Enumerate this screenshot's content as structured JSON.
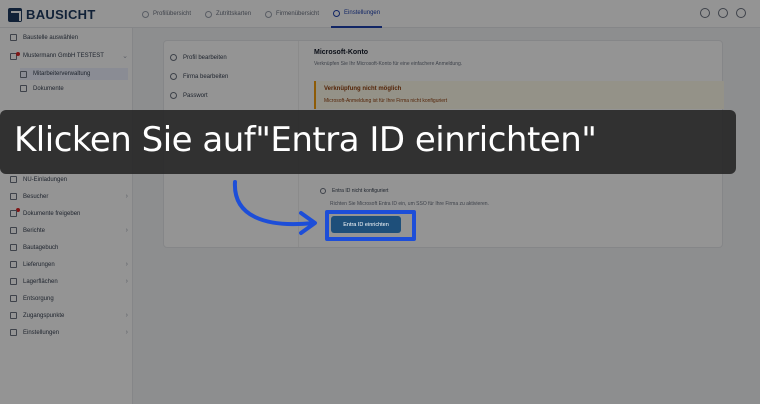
{
  "brand": {
    "name": "BAUSICHT"
  },
  "nav": {
    "tabs": [
      {
        "label": "Profilübersicht",
        "icon": "user-icon"
      },
      {
        "label": "Zutrittskarten",
        "icon": "card-icon"
      },
      {
        "label": "Firmenübersicht",
        "icon": "building-icon"
      },
      {
        "label": "Einstellungen",
        "icon": "gear-icon",
        "active": true
      }
    ]
  },
  "sidebar": {
    "select_site": "Baustelle auswählen",
    "company": "Mustermann GmbH TESTEST",
    "items": [
      {
        "label": "Mitarbeiterverwaltung"
      },
      {
        "label": "Dokumente"
      },
      {
        "label": "NU-Einladungen"
      },
      {
        "label": "Besucher"
      },
      {
        "label": "Dokumente freigeben"
      },
      {
        "label": "Berichte"
      },
      {
        "label": "Bautagebuch"
      },
      {
        "label": "Lieferungen"
      },
      {
        "label": "Lagerflächen"
      },
      {
        "label": "Entsorgung"
      },
      {
        "label": "Zugangspunkte"
      },
      {
        "label": "Einstellungen"
      }
    ]
  },
  "settings_nav": {
    "items": [
      {
        "label": "Profil bearbeiten"
      },
      {
        "label": "Firma bearbeiten"
      },
      {
        "label": "Passwort"
      }
    ]
  },
  "ms_account": {
    "title": "Microsoft-Konto",
    "description": "Verknüpfen Sie Ihr Microsoft-Konto für eine einfachere Anmeldung.",
    "warning_title": "Verknüpfung nicht möglich",
    "warning_text": "Microsoft-Anmeldung ist für Ihre Firma nicht konfiguriert",
    "entra_status": "Entra ID nicht konfiguriert",
    "entra_desc": "Richten Sie Microsoft Entra ID ein, um SSO für Ihre Firma zu aktivieren.",
    "entra_button": "Entra ID einrichten"
  },
  "overlay": {
    "instruction": "Klicken Sie auf\"Entra ID einrichten\""
  },
  "colors": {
    "brand": "#1e3a5f",
    "accent": "#1e40af",
    "highlight": "#1d4ed8",
    "button": "#1e4f7a",
    "warning_bg": "#fffbeb"
  }
}
